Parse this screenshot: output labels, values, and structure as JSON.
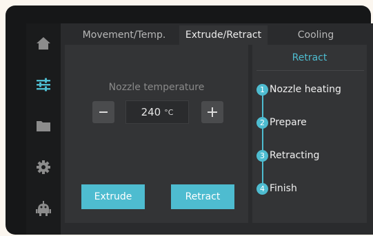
{
  "tabs": [
    {
      "label": "Movement/Temp.",
      "active": false
    },
    {
      "label": "Extrude/Retract",
      "active": true
    },
    {
      "label": "Cooling",
      "active": false
    }
  ],
  "sidebar": {
    "items": [
      {
        "icon": "home-icon"
      },
      {
        "icon": "sliders-icon",
        "active": true
      },
      {
        "icon": "folder-icon"
      },
      {
        "icon": "gear-icon"
      },
      {
        "icon": "robot-icon"
      }
    ]
  },
  "extrude_panel": {
    "nozzle_label": "Nozzle temperature",
    "decrement_icon": "minus-icon",
    "increment_icon": "plus-icon",
    "temperature_value": "240",
    "temperature_unit": "°C",
    "extrude_label": "Extrude",
    "retract_label": "Retract"
  },
  "retract_panel": {
    "title": "Retract",
    "steps": [
      {
        "number": "1",
        "label": "Nozzle heating"
      },
      {
        "number": "2",
        "label": "Prepare"
      },
      {
        "number": "3",
        "label": "Retracting"
      },
      {
        "number": "4",
        "label": "Finish"
      }
    ]
  },
  "colors": {
    "accent": "#4ebcd0",
    "background": "#2a2b2d",
    "panel": "#333436",
    "sidebar": "#1a1b1c",
    "icon_inactive": "#8c8c8c"
  }
}
